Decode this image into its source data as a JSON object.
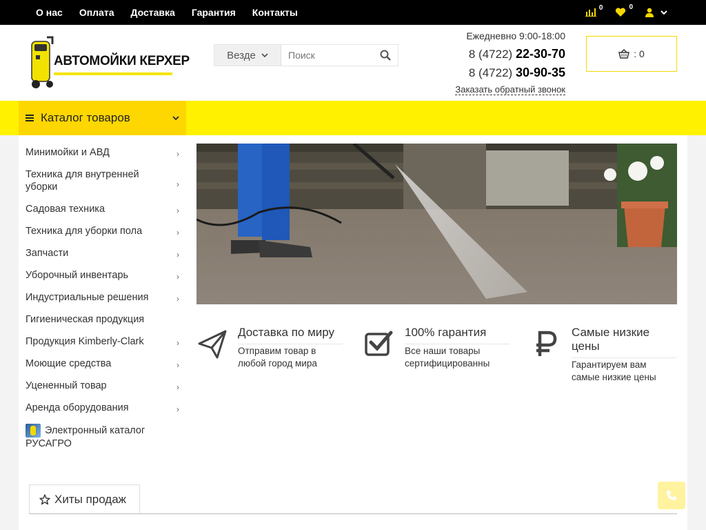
{
  "topnav": {
    "items": [
      "О нас",
      "Оплата",
      "Доставка",
      "Гарантия",
      "Контакты"
    ]
  },
  "topicons": {
    "compare_count": "0",
    "wishlist_count": "0"
  },
  "logo": {
    "text": "АВТОМОЙКИ КЕРХЕР"
  },
  "search": {
    "scope": "Везде",
    "placeholder": "Поиск"
  },
  "contacts": {
    "hours": "Ежедневно 9:00-18:00",
    "phone1_code": "8 (4722)",
    "phone1_num": "22-30-70",
    "phone2_code": "8 (4722)",
    "phone2_num": "30-90-35",
    "callback": "Заказать обратный звонок"
  },
  "cart": {
    "label": ": 0"
  },
  "catalog": {
    "label": "Каталог товаров"
  },
  "sidebar": {
    "items": [
      {
        "label": "Минимойки и АВД",
        "arrow": "›"
      },
      {
        "label": "Техника для внутренней уборки",
        "arrow": "›"
      },
      {
        "label": "Садовая техника",
        "arrow": "›"
      },
      {
        "label": "Техника для уборки пола",
        "arrow": "›"
      },
      {
        "label": "Запчасти",
        "arrow": "›"
      },
      {
        "label": "Уборочный инвентарь",
        "arrow": "›"
      },
      {
        "label": "Индустриальные решения",
        "arrow": "›"
      },
      {
        "label": "Гигиеническая продукция",
        "arrow": ""
      },
      {
        "label": "Продукция Kimberly-Clark",
        "arrow": "›"
      },
      {
        "label": "Моющие средства",
        "arrow": "›"
      },
      {
        "label": "Уцененный товар",
        "arrow": "›"
      },
      {
        "label": "Аренда оборудования",
        "arrow": "›"
      }
    ],
    "rusagro": "Электронный каталог РУСАГРО"
  },
  "features": [
    {
      "title": "Доставка по миру",
      "desc": "Отправим товар в любой город мира",
      "icon": "paper-plane-icon"
    },
    {
      "title": "100% гарантия",
      "desc": "Все наши товары сертифицированны",
      "icon": "check-square-icon"
    },
    {
      "title": "Самые низкие цены",
      "desc": "Гарантируем вам самые низкие цены",
      "icon": "ruble-icon"
    }
  ],
  "tabs": {
    "hits": "Хиты продаж"
  },
  "colors": {
    "accent": "#fff100",
    "accent_dark": "#ffd700",
    "topbar": "#000000"
  }
}
